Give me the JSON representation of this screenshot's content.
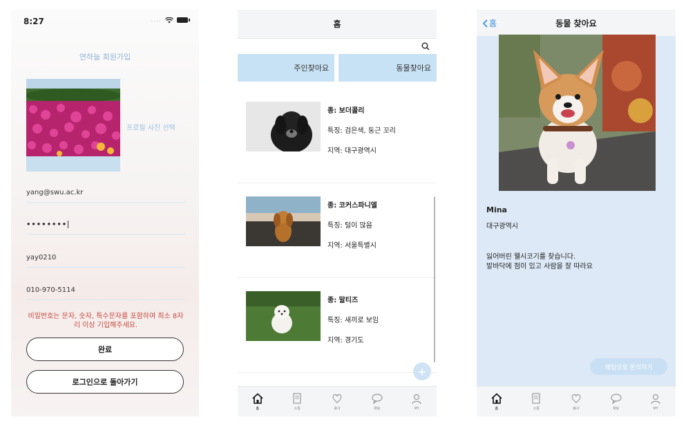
{
  "signup": {
    "status_time": "8:27",
    "title": "연하늘 회원가입",
    "profile_select": "프로필 사진 선택",
    "email": "yang@swu.ac.kr",
    "password": "••••••••",
    "user_id": "yay0210",
    "phone": "010-970-5114",
    "warning": "비밀번호는 문자, 숫자, 특수문자를 포함하여 최소 8자리 이상 기입해주세요.",
    "done_label": "완료",
    "back_to_login_label": "로그인으로 돌아가기"
  },
  "home": {
    "title": "홈",
    "tabs": [
      "주인찾아요",
      "동물찾아요"
    ],
    "listings": [
      {
        "species": "종: 보더콜리",
        "features": "특징: 검은색, 둥근 꼬리",
        "region": "지역: 대구광역시"
      },
      {
        "species": "종: 코커스파니엘",
        "features": "특징: 털이 많음",
        "region": "지역: 서울특별시"
      },
      {
        "species": "종: 말티즈",
        "features": "특징: 새끼로 보임",
        "region": "지역: 경기도"
      }
    ],
    "fab_label": "+"
  },
  "tabbar": {
    "items": [
      {
        "label": "홈",
        "icon": "home-icon"
      },
      {
        "label": "소통",
        "icon": "document-icon"
      },
      {
        "label": "봉사",
        "icon": "heart-icon"
      },
      {
        "label": "채팅",
        "icon": "chat-icon"
      },
      {
        "label": "MY",
        "icon": "person-icon"
      }
    ]
  },
  "detail": {
    "back_label": "홈",
    "title": "동물 찾아요",
    "owner_name": "Mina",
    "owner_region": "대구광역시",
    "description_line1": "잃어버린 웰시코기를 찾습니다.",
    "description_line2": "발바닥에 점이 있고 사람을 잘 따라요",
    "chat_label": "채팅으로 문의하기"
  },
  "colors": {
    "accent_blue": "#3b8fe0",
    "segment_bg": "#c8e2f5",
    "warning_red": "#c64a3f",
    "detail_bg": "#dde9f7"
  }
}
